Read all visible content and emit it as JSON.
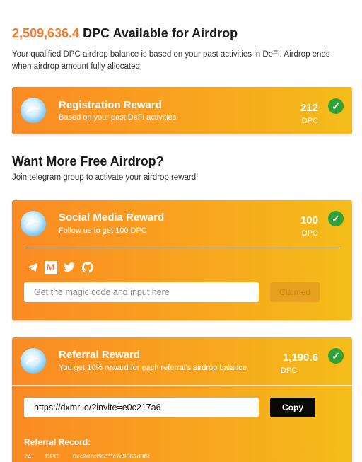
{
  "hero": {
    "amount": "2,509,636.4",
    "title_suffix": "DPC Available for Airdrop",
    "description": "Your qualified DPC airdrop balance is based on your past activities in DeFi. Airdrop ends when airdrop amount fully allocated."
  },
  "registration": {
    "title": "Registration Reward",
    "subtitle": "Based on your past DeFi activities",
    "amount": "212",
    "unit": "DPC",
    "check": "✓"
  },
  "more": {
    "title": "Want More Free Airdrop?",
    "description": "Join telegram group to activate your airdrop reward!"
  },
  "social": {
    "title": "Social Media Reward",
    "subtitle": "Follow us to get 100 DPC",
    "amount": "100",
    "unit": "DPC",
    "check": "✓",
    "medium_letter": "M",
    "icons": [
      "telegram-icon",
      "medium-icon",
      "twitter-icon",
      "github-icon"
    ],
    "input_placeholder": "Get the magic code and input here",
    "button_label": "Claimed"
  },
  "referral": {
    "title": "Referral Reward",
    "subtitle": "You get 10% reward for each referral's airdrop balance",
    "amount": "1,190.6",
    "unit": "DPC",
    "check": "✓",
    "link_value": "https://dxmr.io/?invite=e0c217a6",
    "button_label": "Copy",
    "record_label": "Referral Record:",
    "records": [
      {
        "amount": "24",
        "unit": "DPC",
        "address": "0xc2d7cf95***c7c9061d3f9"
      }
    ]
  },
  "colors": {
    "accent": "#f47b2a",
    "card_start": "#fb8a24",
    "card_end": "#f3bd19",
    "check": "#2fa33a"
  }
}
